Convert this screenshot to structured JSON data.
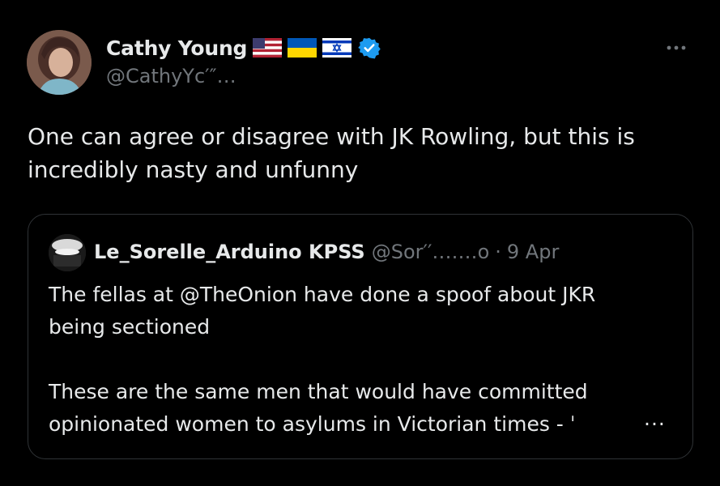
{
  "author": {
    "display_name": "Cathy Young",
    "handle": "@CathyYc′″․․․",
    "flags": [
      "us-flag-icon",
      "ukraine-flag-icon",
      "israel-flag-icon"
    ],
    "verified": true
  },
  "tweet": {
    "text": "One can agree or disagree with JK Rowling, but this is\nincredibly nasty and unfunny"
  },
  "quoted_tweet": {
    "display_name": "Le_Sorelle_Arduino KPSS",
    "handle": "@Sor′′․․․․․․․o",
    "separator": "·",
    "date": "9 Apr",
    "text": "The fellas at @TheOnion have done a spoof about JKR\nbeing sectioned\n\nThese are the same men that would have committed\nopinionated women to asylums in Victorian times - ˈ",
    "ellipsis": "..."
  },
  "colors": {
    "background": "#000000",
    "text": "#e7e9ea",
    "secondary_text": "#71767b",
    "border": "#2f3336",
    "verified_blue": "#1d9bf0"
  }
}
